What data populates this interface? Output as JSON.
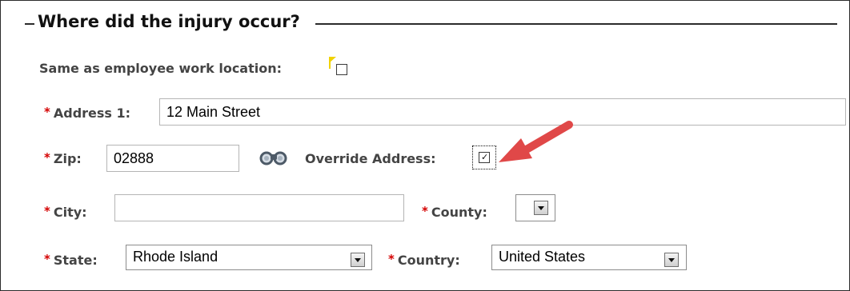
{
  "section": {
    "title": "Where did the injury occur?"
  },
  "same_as_work": {
    "label": "Same as employee work location:",
    "checked": false
  },
  "address1": {
    "label": "Address 1:",
    "value": "12 Main Street"
  },
  "zip": {
    "label": "Zip:",
    "value": "02888",
    "lookup_icon": "binoculars-icon"
  },
  "override_address": {
    "label": "Override Address:",
    "checked": true,
    "mark": "✓"
  },
  "city": {
    "label": "City:",
    "value": ""
  },
  "county": {
    "label": "County:",
    "value": ""
  },
  "state": {
    "label": "State:",
    "value": "Rhode Island"
  },
  "country": {
    "label": "Country:",
    "value": "United States"
  },
  "required_marker": "*",
  "colors": {
    "required": "#d40000",
    "annotation_arrow": "#e04848",
    "flag": "#f1d200"
  }
}
